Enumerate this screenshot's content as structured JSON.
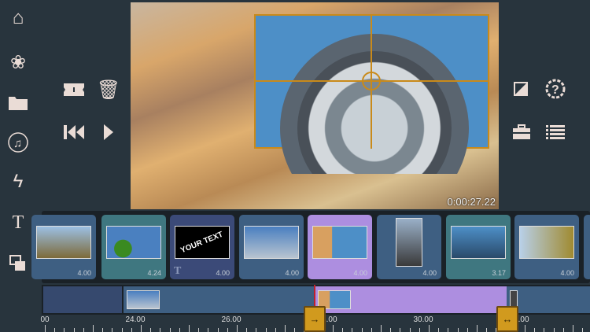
{
  "sidebar": {
    "items": [
      {
        "name": "home-icon"
      },
      {
        "name": "effects-icon"
      },
      {
        "name": "folder-icon"
      },
      {
        "name": "music-icon"
      },
      {
        "name": "transition-icon"
      },
      {
        "name": "text-icon",
        "glyph": "T"
      },
      {
        "name": "overlay-icon"
      }
    ]
  },
  "tools": {
    "split": "split-icon",
    "delete": "trash-icon",
    "rewind": "skip-back-icon",
    "play": "play-icon"
  },
  "right_tools": [
    "image-adjust-icon",
    "help-icon",
    "toolbox-icon",
    "list-icon"
  ],
  "preview": {
    "timecode": "0:00:27.22"
  },
  "clips": [
    {
      "duration": "4.00",
      "type": "video"
    },
    {
      "duration": "4.24",
      "type": "video"
    },
    {
      "duration": "4.00",
      "type": "text",
      "thumb_text": "YOUR TEXT",
      "badge": "T"
    },
    {
      "duration": "4.00",
      "type": "video"
    },
    {
      "duration": "4.00",
      "type": "video",
      "selected": true
    },
    {
      "duration": "4.00",
      "type": "video"
    },
    {
      "duration": "3.17",
      "type": "video"
    },
    {
      "duration": "4.00",
      "type": "video"
    }
  ],
  "ruler": {
    "labels": [
      "00",
      "24.00",
      "26.00",
      "28.00",
      "30.00",
      "32.00"
    ]
  },
  "handles": {
    "start": "→",
    "end": "↔"
  },
  "colors": {
    "selected": "#ad8ee0",
    "handle": "#d19a1e",
    "bg": "#28343d"
  }
}
